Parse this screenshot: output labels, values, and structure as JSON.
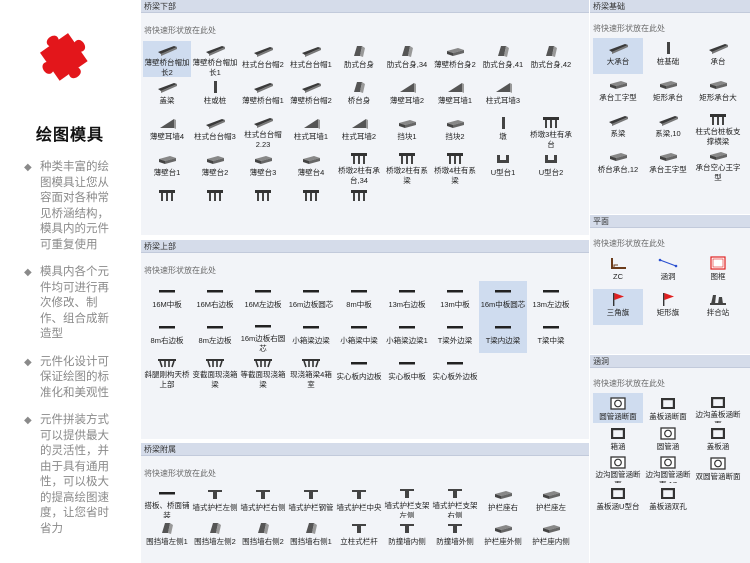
{
  "intro": {
    "title": "绘图模具",
    "bullets": [
      "种类丰富的绘图模具让您从容面对各种常见桥涵结构，模具内的元件可重复使用",
      "模具内各个元件均可进行再次修改、制作、组合成新造型",
      "元件化设计可保证绘图的标准化和美观性",
      "元件拼装方式可以提供最大的灵活性，并由于具有通用性，可以极大的提高绘图速度，让您省时省力"
    ]
  },
  "panels": {
    "lower": {
      "title": "桥梁下部",
      "hint": "将快速形状放在此处",
      "items": [
        {
          "label": "薄壁桥台帽加长2",
          "icon": "beam-icon",
          "selected": true
        },
        {
          "label": "薄壁桥台帽加长1",
          "icon": "beam-icon"
        },
        {
          "label": "柱式台台帽2",
          "icon": "beam-icon"
        },
        {
          "label": "柱式台台帽1",
          "icon": "beam-icon"
        },
        {
          "label": "肋式台身",
          "icon": "wall-icon"
        },
        {
          "label": "肋式台身,34",
          "icon": "wall-icon"
        },
        {
          "label": "薄壁桥台身2",
          "icon": "block-icon"
        },
        {
          "label": "肋式台身,41",
          "icon": "wall-icon"
        },
        {
          "label": "肋式台身,42",
          "icon": "wall-icon"
        },
        {
          "label": "盖梁",
          "icon": "beam-icon"
        },
        {
          "label": "柱或桩",
          "icon": "post-icon"
        },
        {
          "label": "薄壁桥台帽1",
          "icon": "beam-icon"
        },
        {
          "label": "薄壁桥台帽2",
          "icon": "beam-icon"
        },
        {
          "label": "桥台身",
          "icon": "wall-icon"
        },
        {
          "label": "薄壁耳墙2",
          "icon": "wedge-icon"
        },
        {
          "label": "薄壁耳墙1",
          "icon": "wedge-icon"
        },
        {
          "label": "柱式耳墙3",
          "icon": "wedge-icon"
        },
        {
          "label": "",
          "icon": ""
        },
        {
          "label": "薄壁耳墙4",
          "icon": "wedge-icon"
        },
        {
          "label": "柱式台台帽3",
          "icon": "beam-icon"
        },
        {
          "label": "柱式台台帽2.23",
          "icon": "beam-icon"
        },
        {
          "label": "柱式耳墙1",
          "icon": "wedge-icon"
        },
        {
          "label": "柱式耳墙2",
          "icon": "wedge-icon"
        },
        {
          "label": "挡块1",
          "icon": "block-icon"
        },
        {
          "label": "挡块2",
          "icon": "block-icon"
        },
        {
          "label": "墩",
          "icon": "post-icon"
        },
        {
          "label": "桥墩3柱有承台",
          "icon": "pier-icon"
        },
        {
          "label": "薄壁台1",
          "icon": "block-icon"
        },
        {
          "label": "薄壁台2",
          "icon": "block-icon"
        },
        {
          "label": "薄壁台3",
          "icon": "block-icon"
        },
        {
          "label": "薄壁台4",
          "icon": "block-icon"
        },
        {
          "label": "桥墩2柱有承台,34",
          "icon": "pier-icon"
        },
        {
          "label": "桥墩2柱有系梁",
          "icon": "pier-icon"
        },
        {
          "label": "桥墩4柱有系梁",
          "icon": "pier-icon"
        },
        {
          "label": "U型台1",
          "icon": "u-icon"
        },
        {
          "label": "U型台2",
          "icon": "u-icon"
        },
        {
          "label": "",
          "icon": "pier-icon"
        },
        {
          "label": "",
          "icon": "pier-icon"
        },
        {
          "label": "",
          "icon": "pier-icon"
        },
        {
          "label": "",
          "icon": "pier-icon"
        },
        {
          "label": "",
          "icon": "pier-icon"
        }
      ]
    },
    "upper": {
      "title": "桥梁上部",
      "hint": "将快速形状放在此处",
      "items": [
        {
          "label": "16M中板",
          "icon": "slab-icon"
        },
        {
          "label": "16M右边板",
          "icon": "slab-icon"
        },
        {
          "label": "16M左边板",
          "icon": "slab-icon"
        },
        {
          "label": "16m边板圆芯",
          "icon": "slab-icon"
        },
        {
          "label": "8m中板",
          "icon": "slab-icon"
        },
        {
          "label": "13m右边板",
          "icon": "slab-icon"
        },
        {
          "label": "13m中板",
          "icon": "slab-icon"
        },
        {
          "label": "16m中板圆芯",
          "icon": "slab-icon",
          "selected": true
        },
        {
          "label": "13m左边板",
          "icon": "slab-icon"
        },
        {
          "label": "8m右边板",
          "icon": "slab-icon"
        },
        {
          "label": "8m左边板",
          "icon": "slab-icon"
        },
        {
          "label": "16m边板右圆芯",
          "icon": "slab-icon"
        },
        {
          "label": "小箱梁边梁",
          "icon": "slab-icon"
        },
        {
          "label": "小箱梁中梁",
          "icon": "slab-icon"
        },
        {
          "label": "小箱梁边梁1",
          "icon": "slab-icon"
        },
        {
          "label": "T梁外边梁",
          "icon": "slab-icon"
        },
        {
          "label": "T梁内边梁",
          "icon": "slab-icon",
          "selected": true
        },
        {
          "label": "T梁中梁",
          "icon": "slab-icon"
        },
        {
          "label": "斜腿刚构天桥上部",
          "icon": "truss-icon"
        },
        {
          "label": "变截面现浇箱梁",
          "icon": "truss-icon"
        },
        {
          "label": "等截面现浇箱梁",
          "icon": "truss-icon"
        },
        {
          "label": "现浇箱梁4箱室",
          "icon": "truss-icon"
        },
        {
          "label": "实心板内边板",
          "icon": "slab-icon"
        },
        {
          "label": "实心板中板",
          "icon": "slab-icon"
        },
        {
          "label": "实心板外边板",
          "icon": "slab-icon"
        }
      ]
    },
    "attach": {
      "title": "桥梁附属",
      "hint": "将快速形状放在此处",
      "items": [
        {
          "label": "搭板、桥面铺装",
          "icon": "slab-icon"
        },
        {
          "label": "墙式护栏左侧",
          "icon": "rail-icon"
        },
        {
          "label": "墙式护栏右侧",
          "icon": "rail-icon"
        },
        {
          "label": "墙式护栏钢管",
          "icon": "rail-icon"
        },
        {
          "label": "墙式护栏中央",
          "icon": "rail-icon"
        },
        {
          "label": "墙式护栏支架左侧",
          "icon": "rail-icon"
        },
        {
          "label": "墙式护栏支架右侧",
          "icon": "rail-icon"
        },
        {
          "label": "护栏座右",
          "icon": "block-icon"
        },
        {
          "label": "护栏座左",
          "icon": "block-icon"
        },
        {
          "label": "围挡墙左侧1",
          "icon": "wall-icon"
        },
        {
          "label": "围挡墙左侧2",
          "icon": "wall-icon"
        },
        {
          "label": "围挡墙右侧2",
          "icon": "wall-icon"
        },
        {
          "label": "围挡墙右侧1",
          "icon": "wall-icon"
        },
        {
          "label": "立柱式栏杆",
          "icon": "rail-icon"
        },
        {
          "label": "防撞墙内侧",
          "icon": "rail-icon"
        },
        {
          "label": "防撞墙外侧",
          "icon": "rail-icon"
        },
        {
          "label": "护栏座外侧",
          "icon": "block-icon"
        },
        {
          "label": "护栏座内侧",
          "icon": "block-icon"
        }
      ]
    },
    "found": {
      "title": "桥梁基础",
      "hint": "将快速形状放在此处",
      "items": [
        {
          "label": "大承台",
          "icon": "beam-icon",
          "selected": true
        },
        {
          "label": "桩基础",
          "icon": "post-icon"
        },
        {
          "label": "承台",
          "icon": "beam-icon"
        },
        {
          "label": "承台工字型",
          "icon": "block-icon"
        },
        {
          "label": "矩形承台",
          "icon": "block-icon"
        },
        {
          "label": "矩形承台大",
          "icon": "block-icon"
        },
        {
          "label": "系梁",
          "icon": "beam-icon"
        },
        {
          "label": "系梁,10",
          "icon": "beam-icon"
        },
        {
          "label": "柱式台桩板支撑横梁",
          "icon": "pier-icon"
        },
        {
          "label": "桥台承台,12",
          "icon": "block-icon"
        },
        {
          "label": "承台王字型",
          "icon": "block-icon"
        },
        {
          "label": "承台空心王字型",
          "icon": "block-icon"
        }
      ]
    },
    "plane": {
      "title": "平面",
      "hint": "将快速形状放在此处",
      "items": [
        {
          "label": "ZC",
          "icon": "zc-icon"
        },
        {
          "label": "涵洞",
          "icon": "culvert-line-icon"
        },
        {
          "label": "图框",
          "icon": "frame-icon"
        },
        {
          "label": "三角旗",
          "icon": "flag-icon",
          "selected": true
        },
        {
          "label": "矩形旗",
          "icon": "flag-icon"
        },
        {
          "label": "拌合站",
          "icon": "plant-icon"
        }
      ]
    },
    "culv": {
      "title": "涵洞",
      "hint": "将快速形状放在此处",
      "items": [
        {
          "label": "圆管涵断面",
          "icon": "pipe-icon",
          "selected": true
        },
        {
          "label": "盖板涵断面",
          "icon": "box-icon"
        },
        {
          "label": "边沟盖板涵断面",
          "icon": "box-icon"
        },
        {
          "label": "箱涵",
          "icon": "box-icon"
        },
        {
          "label": "圆管涵",
          "icon": "pipe-icon"
        },
        {
          "label": "盖板涵",
          "icon": "box-icon"
        },
        {
          "label": "边沟圆管涵断面",
          "icon": "pipe-icon"
        },
        {
          "label": "边沟圆管涵断面,17",
          "icon": "pipe-icon"
        },
        {
          "label": "双圆管涵断面",
          "icon": "pipe-icon"
        },
        {
          "label": "盖板涵U型台",
          "icon": "box-icon"
        },
        {
          "label": "盖板涵双孔",
          "icon": "box-icon"
        }
      ]
    }
  },
  "colors": {
    "logo": "#e3161b",
    "panel_bg": "#f2f4f8",
    "header_bg": "#d5dcea",
    "selected_bg": "#cfdcef",
    "bullet_text": "#8a8a8a",
    "flag": "#e02020",
    "accent_line": "#2a50d0"
  }
}
